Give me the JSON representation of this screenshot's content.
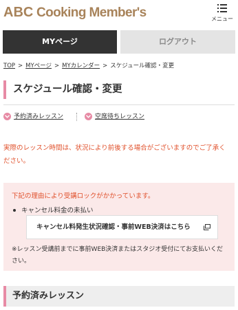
{
  "header": {
    "logo_text": "Cooking Member's",
    "logo_prefix": "ABC",
    "menu_label": "メニュー"
  },
  "tabs": [
    {
      "label": "MYページ"
    },
    {
      "label": "ログアウト"
    }
  ],
  "breadcrumb": [
    "TOP",
    "MYページ",
    "MYカレンダー",
    "スケジュール確認・変更"
  ],
  "page_title": "スケジュール確認・変更",
  "anchors": [
    {
      "label": "予約済みレッスン"
    },
    {
      "label": "空席待ちレッスン"
    }
  ],
  "notice": "実際のレッスン時間は、状況により前後する場合がございますのでご了承ください。",
  "lock_box": {
    "title": "下記の理由により受講ロックがかかっています。",
    "reason": "キャンセル料金の未払い",
    "button_label": "キャンセル料発生状況確認・事前WEB決済はこちら",
    "note": "※レッスン受講前までに事前WEB決済またはスタジオ受付にてお支払いください。"
  },
  "section_title": "予約済みレッスン",
  "colors": {
    "brand": "#a8835a",
    "accent_pink": "#e78ba5",
    "notice_red": "#e0502b",
    "lock_bg": "#fbe9e9",
    "tab_active": "#333333",
    "tab_inactive": "#e4e4e4"
  },
  "icons": {
    "menu": "hamburger-list-icon",
    "anchor": "chevron-down-circle-icon",
    "external": "external-window-icon"
  }
}
